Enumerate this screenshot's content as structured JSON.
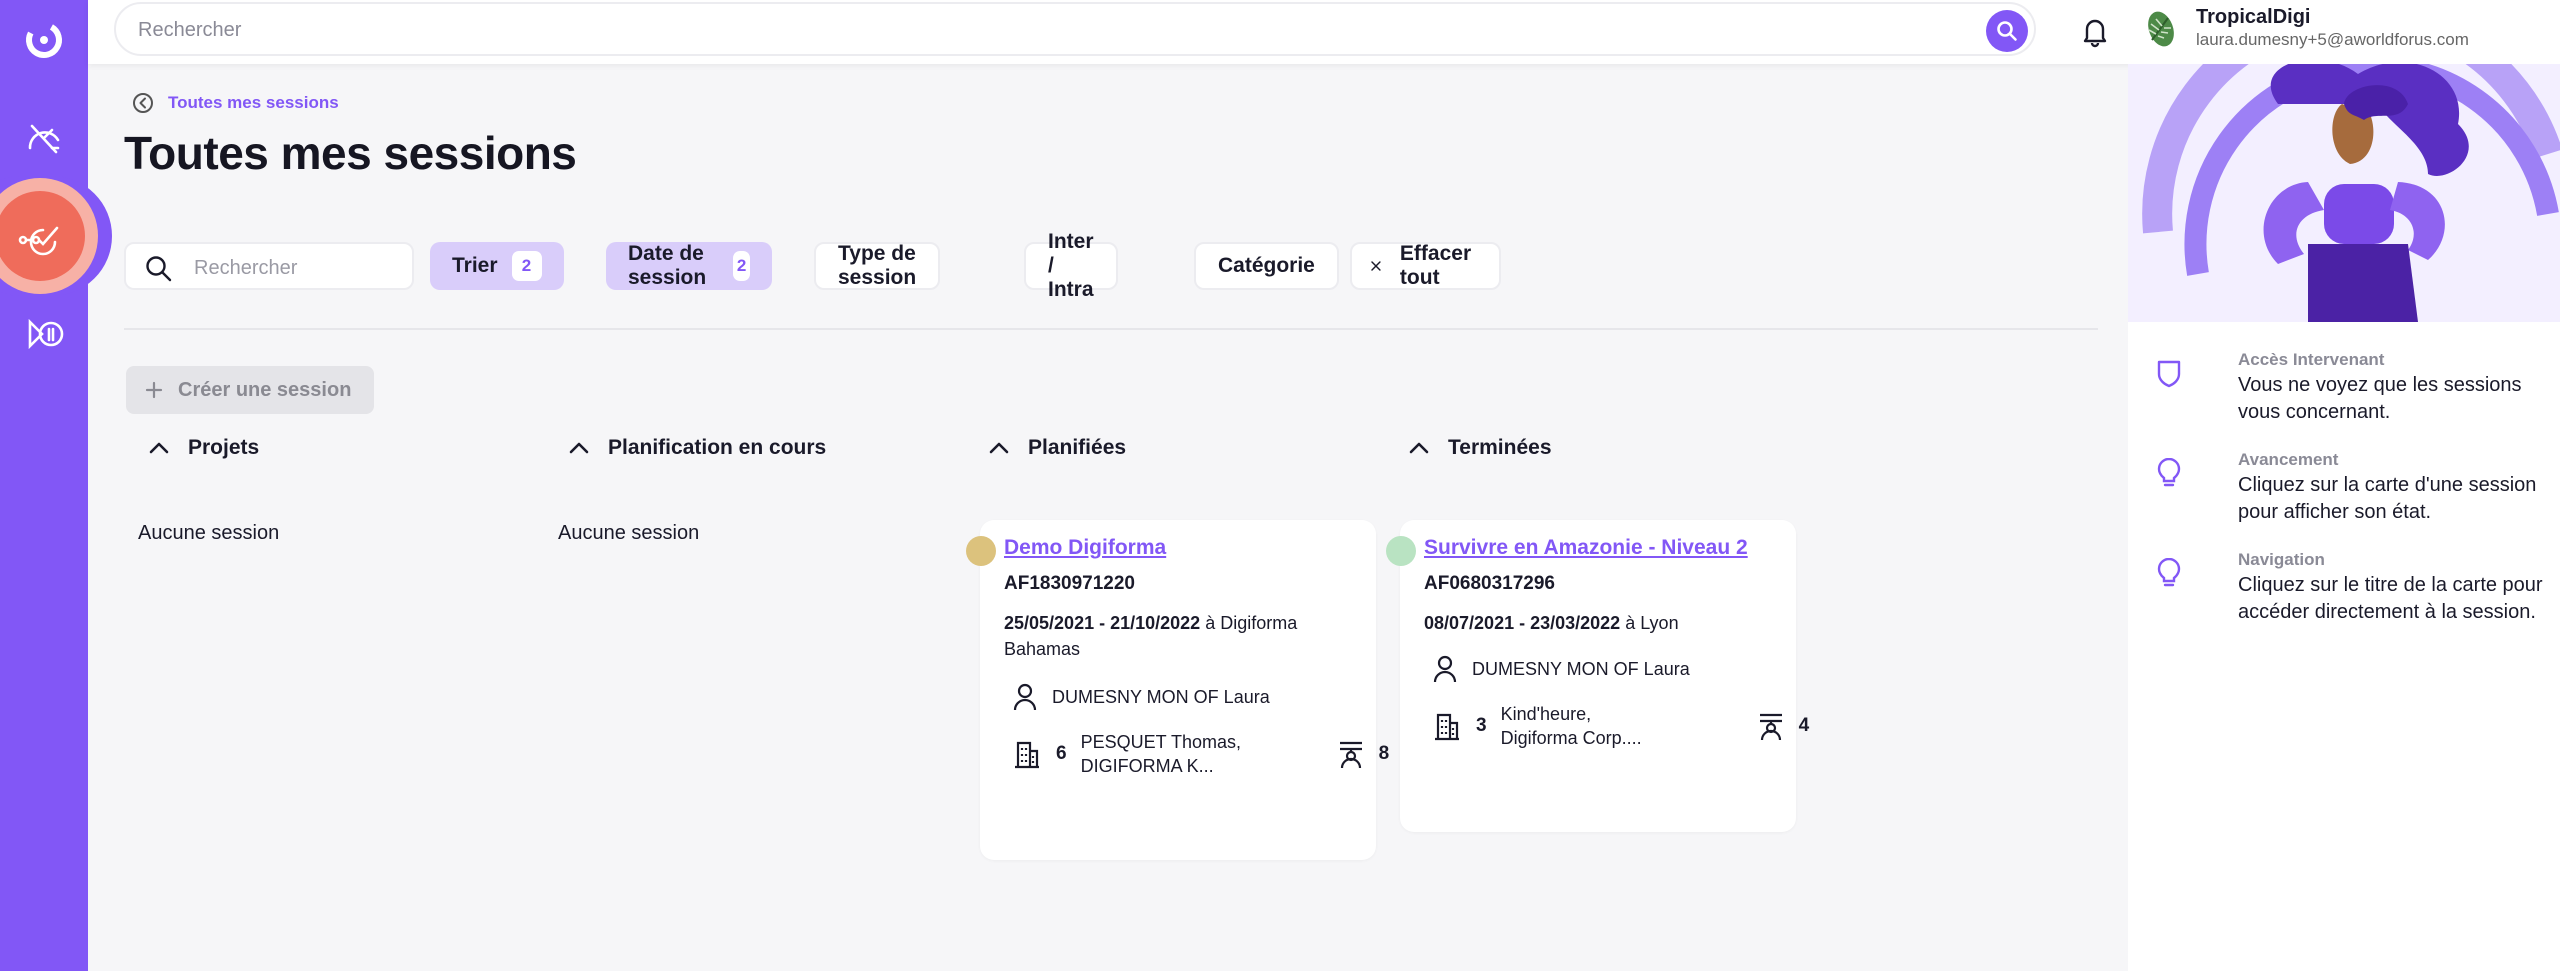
{
  "topbar": {
    "search_placeholder": "Rechercher",
    "org_name": "TropicalDigi",
    "org_email": "laura.dumesny+5@aworldforus.com"
  },
  "breadcrumb": {
    "label": "Toutes mes sessions"
  },
  "page": {
    "title": "Toutes mes sessions"
  },
  "filters": {
    "search_placeholder": "Rechercher",
    "sort_label": "Trier",
    "sort_count": "2",
    "date_label": "Date de session",
    "date_count": "2",
    "type_label": "Type de session",
    "inter_label": "Inter / Intra",
    "category_label": "Catégorie",
    "clear_label": "Effacer tout"
  },
  "create_button": {
    "label": "Créer une session"
  },
  "columns": [
    {
      "title": "Projets",
      "empty": "Aucune session"
    },
    {
      "title": "Planification en cours",
      "empty": "Aucune session"
    },
    {
      "title": "Planifiées"
    },
    {
      "title": "Terminées"
    }
  ],
  "cards": [
    {
      "title": "Demo Digiforma",
      "code": "AF1830971220",
      "dates": "25/05/2021 - 21/10/2022",
      "location_prefix": "à",
      "location": "Digiforma Bahamas",
      "trainer": "DUMESNY MON OF Laura",
      "companies_count": "6",
      "companies": "PESQUET Thomas, DIGIFORMA K...",
      "learners_count": "8",
      "dot_color": "#dcc27d"
    },
    {
      "title": "Survivre en Amazonie - Niveau 2",
      "code": "AF0680317296",
      "dates": "08/07/2021 - 23/03/2022",
      "location_prefix": "à",
      "location": "Lyon",
      "trainer": "DUMESNY MON OF Laura",
      "companies_count": "3",
      "companies": "Kind'heure, Digiforma Corp....",
      "learners_count": "4",
      "dot_color": "#b9e3c2"
    }
  ],
  "tips": [
    {
      "label": "Accès Intervenant",
      "text": "Vous ne voyez que les sessions vous concernant.",
      "icon": "shield-icon"
    },
    {
      "label": "Avancement",
      "text": "Cliquez sur la carte d'une session pour afficher son état.",
      "icon": "lightbulb-icon"
    },
    {
      "label": "Navigation",
      "text": "Cliquez sur le titre de la carte pour accéder directement à la session.",
      "icon": "lightbulb-icon"
    }
  ],
  "colors": {
    "accent": "#8257f6",
    "active_nav": "#ef6c5b",
    "selected_chip": "#d9cdfa"
  }
}
